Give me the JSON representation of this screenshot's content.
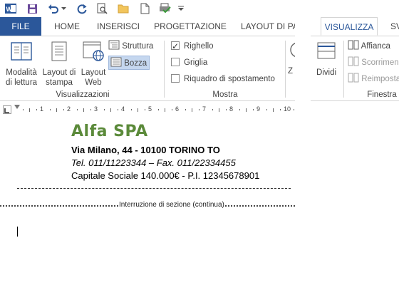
{
  "tabs": {
    "file": "FILE",
    "home": "HOME",
    "insert": "INSERISCI",
    "design": "PROGETTAZIONE",
    "layout": "LAYOUT DI PA",
    "view": "VISUALIZZA",
    "view_next": "SV"
  },
  "ribbon": {
    "views": {
      "reading_mode": [
        "Modalità",
        "di lettura"
      ],
      "print_layout": [
        "Layout di",
        "stampa"
      ],
      "web_layout": [
        "Layout",
        "Web"
      ],
      "outline": "Struttura",
      "draft": "Bozza",
      "label": "Visualizzazioni"
    },
    "show": {
      "ruler": "Righello",
      "ruler_checked": true,
      "gridlines": "Griglia",
      "gridlines_checked": false,
      "navigation_pane": "Riquadro di spostamento",
      "navigation_pane_checked": false,
      "label": "Mostra"
    },
    "zoom_partial": "Z",
    "window": {
      "split": "Dividi",
      "side_by_side": "Affianca",
      "sync_scrolling": "Scorrimen",
      "reset_position": "Reimposta",
      "label": "Finestra"
    }
  },
  "ruler": {
    "labels": [
      "1",
      "2",
      "3",
      "4",
      "5",
      "6",
      "7",
      "8",
      "9",
      "10"
    ]
  },
  "document": {
    "company": "Alfa SPA",
    "address": "Via Milano, 44 - 10100 TORINO TO",
    "contacts": "Tel. 011/11223344 – Fax. 011/22334455",
    "capital": "Capitale Sociale 140.000€ - P.I. 12345678901",
    "section_break": "Interruzione di sezione (continua)"
  },
  "colors": {
    "file_tab": "#2b579a",
    "accent": "#2b579a",
    "title_green": "#5b8a3a",
    "selected_btn": "#c5d7ef"
  },
  "icons": {
    "word_logo": "word-logo-icon",
    "save": "save-icon",
    "undo": "undo-icon",
    "redo": "redo-icon",
    "print_preview": "print-preview-icon",
    "open_folder": "open-folder-icon",
    "new_document": "new-document-icon",
    "spelling": "spelling-check-icon",
    "customize": "customize-qat-icon"
  }
}
